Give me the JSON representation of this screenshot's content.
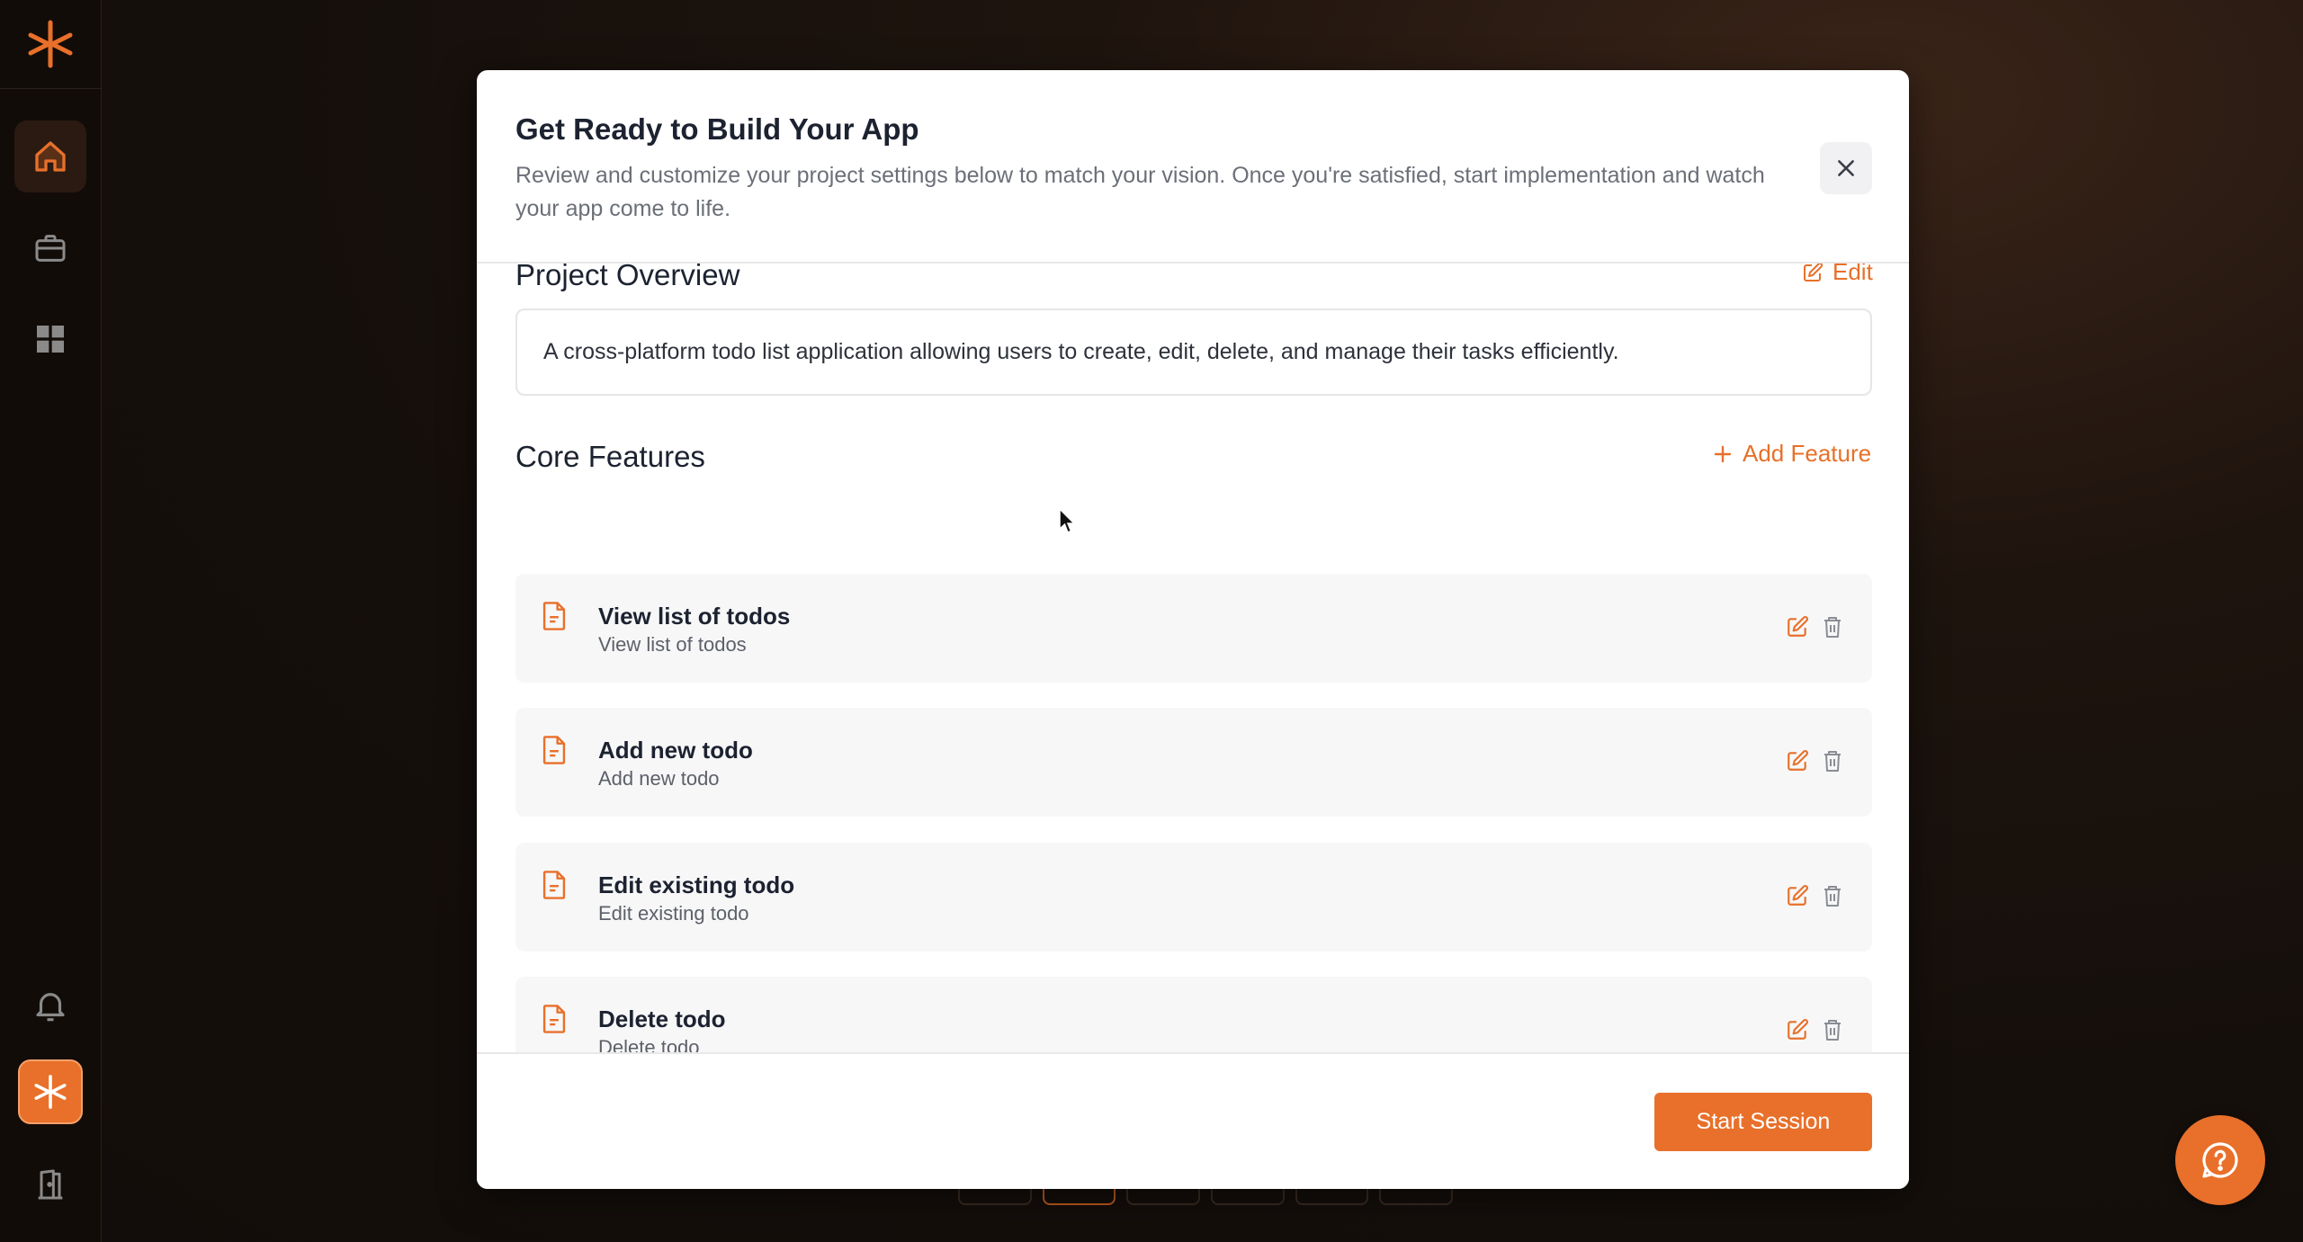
{
  "modal": {
    "title": "Get Ready to Build Your App",
    "subtitle": "Review and customize your project settings below to match your vision. Once you're satisfied, start implementation and watch your app come to life.",
    "overview": {
      "heading": "Project Overview",
      "edit_label": "Edit",
      "text": "A cross-platform todo list application allowing users to create, edit, delete, and manage their tasks efficiently."
    },
    "features": {
      "heading": "Core Features",
      "add_label": "Add Feature",
      "items": [
        {
          "name": "View list of todos",
          "description": "View list of todos"
        },
        {
          "name": "Add new todo",
          "description": "Add new todo"
        },
        {
          "name": "Edit existing todo",
          "description": "Edit existing todo"
        },
        {
          "name": "Delete todo",
          "description": "Delete todo"
        }
      ]
    },
    "start_button": "Start Session"
  },
  "colors": {
    "accent": "#e8702a",
    "background": "#140e0a",
    "card": "#f7f7f8"
  },
  "sidebar": {
    "items": [
      {
        "icon": "home-icon",
        "active": true
      },
      {
        "icon": "briefcase-icon",
        "active": false
      },
      {
        "icon": "grid-icon",
        "active": false
      },
      {
        "icon": "bell-icon",
        "active": false
      },
      {
        "icon": "brand-icon",
        "active": false
      },
      {
        "icon": "logout-icon",
        "active": false
      }
    ]
  }
}
